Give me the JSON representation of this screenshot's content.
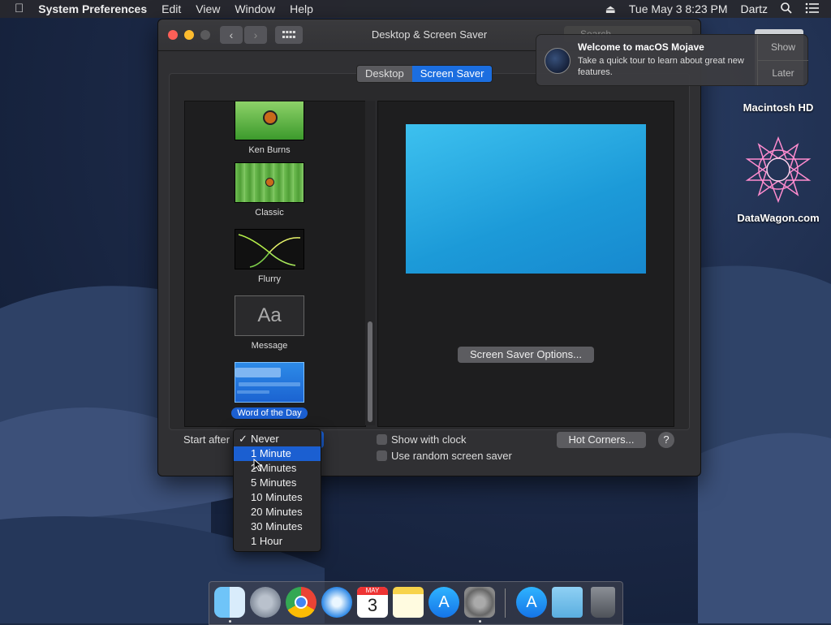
{
  "menubar": {
    "app": "System Preferences",
    "items": [
      "Edit",
      "View",
      "Window",
      "Help"
    ],
    "datetime": "Tue May 3  8:23 PM",
    "user": "Dartz"
  },
  "desktop_icons": {
    "hd": "Macintosh HD",
    "web": "DataWagon.com"
  },
  "window": {
    "title": "Desktop & Screen Saver",
    "search_placeholder": "Search",
    "tabs": {
      "desktop": "Desktop",
      "screensaver": "Screen Saver"
    }
  },
  "savers": [
    {
      "label": "Ken Burns"
    },
    {
      "label": "Classic"
    },
    {
      "label": "Flurry"
    },
    {
      "label": "Message",
      "thumb_text": "Aa"
    },
    {
      "label": "Word of the Day",
      "selected": true
    }
  ],
  "preview": {
    "options_button": "Screen Saver Options..."
  },
  "controls": {
    "start_after": "Start after",
    "show_clock": "Show with clock",
    "random": "Use random screen saver",
    "hot_corners": "Hot Corners...",
    "help": "?"
  },
  "dropdown": {
    "options": [
      "Never",
      "1 Minute",
      "2 Minutes",
      "5 Minutes",
      "10 Minutes",
      "20 Minutes",
      "30 Minutes",
      "1 Hour"
    ],
    "checked": "Never",
    "highlighted": "1 Minute"
  },
  "notification": {
    "title": "Welcome to macOS Mojave",
    "body": "Take a quick tour to learn about great new features.",
    "show": "Show",
    "later": "Later"
  },
  "dock": {
    "calendar_month": "MAY",
    "calendar_day": "3"
  },
  "colors": {
    "accent": "#1b5fd1",
    "preview": "#1c9ad8"
  }
}
